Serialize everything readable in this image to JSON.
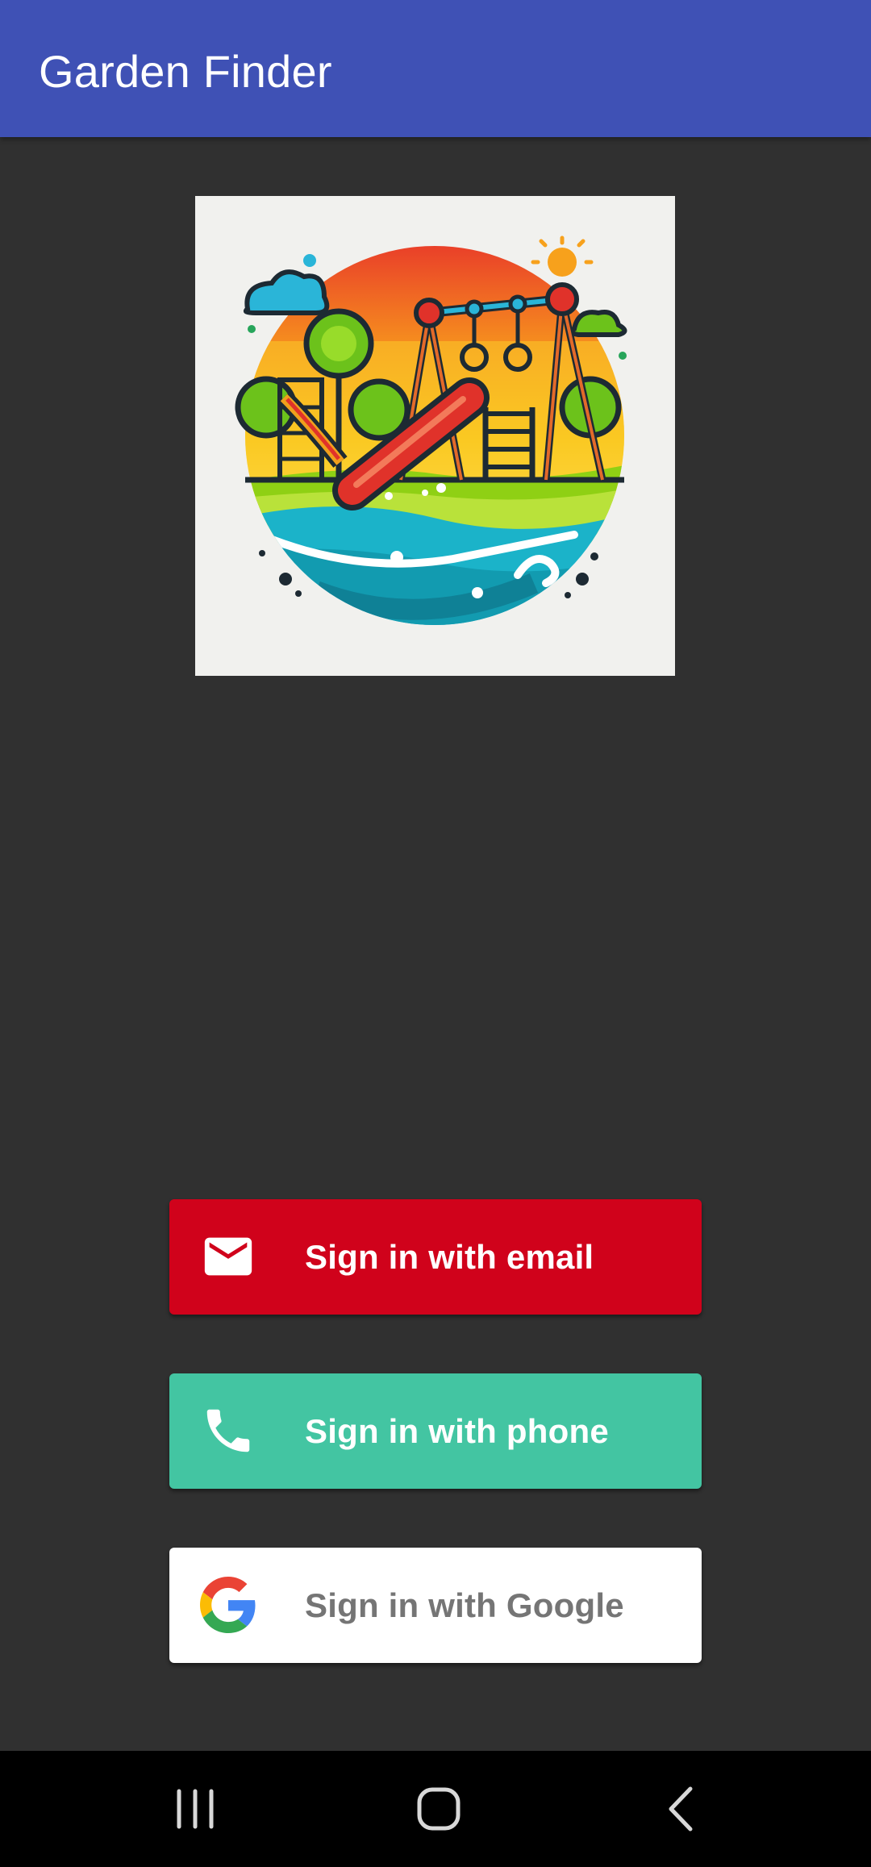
{
  "app_bar": {
    "title": "Garden Finder",
    "color": "#3f51b5"
  },
  "logo": {
    "icon": "playground-logo"
  },
  "buttons": {
    "email": {
      "label": "Sign in with email",
      "icon": "mail-icon",
      "color": "#d0021b"
    },
    "phone": {
      "label": "Sign in with phone",
      "icon": "phone-icon",
      "color": "#43c5a2"
    },
    "google": {
      "label": "Sign in with Google",
      "icon": "google-g-icon",
      "color": "#ffffff"
    }
  },
  "nav_bar": {
    "recent_icon": "recent-apps-icon",
    "home_icon": "home-icon",
    "back_icon": "back-icon"
  },
  "background": "#303030"
}
